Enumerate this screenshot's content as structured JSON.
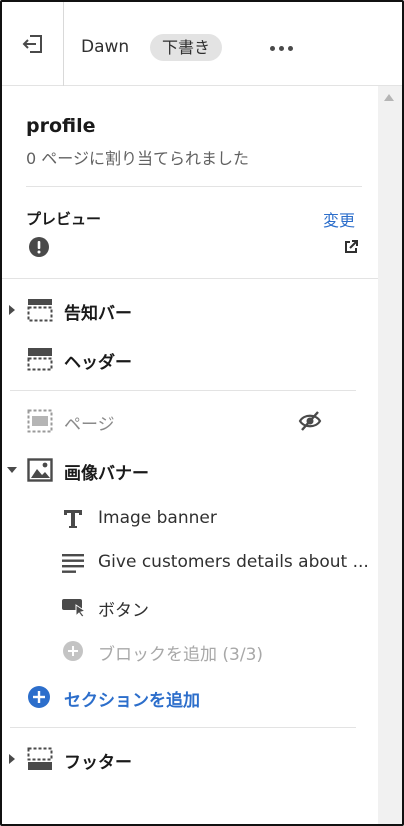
{
  "header": {
    "theme_name": "Dawn",
    "status_badge": "下書き"
  },
  "template": {
    "name": "profile",
    "assigned_text": "0 ページに割り当てられました"
  },
  "preview": {
    "label": "プレビュー",
    "change_link": "変更"
  },
  "sections": {
    "announcement_bar": "告知バー",
    "header": "ヘッダー",
    "page": "ページ",
    "image_banner": "画像バナー",
    "blocks": {
      "heading": "Image banner",
      "text": "Give customers details about ...",
      "button": "ボタン",
      "add_block": "ブロックを追加 (3/3)"
    },
    "add_section": "セクションを追加",
    "footer": "フッター"
  },
  "colors": {
    "accent": "#2c6ecb",
    "text": "#303030",
    "muted": "#8a8a8a"
  }
}
